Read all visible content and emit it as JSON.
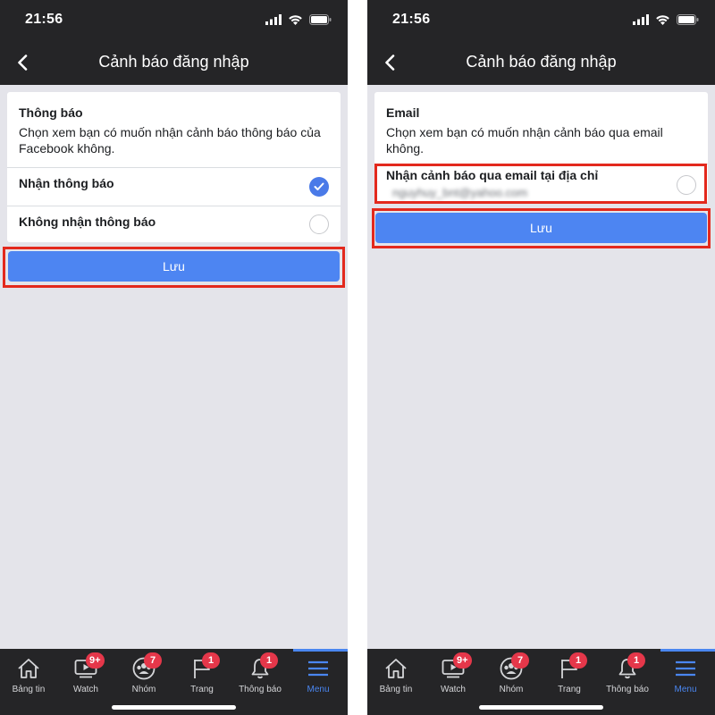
{
  "status": {
    "time": "21:56"
  },
  "colors": {
    "accent": "#4d85f2",
    "highlight": "#e3291d",
    "badge": "#e5374a",
    "bar": "#252527"
  },
  "left": {
    "nav_title": "Cảnh báo đăng nhập",
    "card_title": "Thông báo",
    "card_desc": "Chọn xem bạn có muốn nhận cảnh báo thông báo của Facebook không.",
    "options": [
      {
        "label": "Nhận thông báo",
        "selected": true
      },
      {
        "label": "Không nhận thông báo",
        "selected": false
      }
    ],
    "save_label": "Lưu"
  },
  "right": {
    "nav_title": "Cảnh báo đăng nhập",
    "card_title": "Email",
    "card_desc": "Chọn xem bạn có muốn nhận cảnh báo qua email không.",
    "option_label": "Nhận cảnh báo qua email tại địa chỉ",
    "option_email_blurred": "nguyhuy_bnt@yahoo.com",
    "option_selected": false,
    "save_label": "Lưu"
  },
  "tabbar": {
    "items": [
      {
        "label": "Bảng tin",
        "icon": "home-icon",
        "badge": ""
      },
      {
        "label": "Watch",
        "icon": "watch-icon",
        "badge": "9+"
      },
      {
        "label": "Nhóm",
        "icon": "groups-icon",
        "badge": "7"
      },
      {
        "label": "Trang",
        "icon": "pages-flag-icon",
        "badge": "1"
      },
      {
        "label": "Thông báo",
        "icon": "bell-icon",
        "badge": "1"
      },
      {
        "label": "Menu",
        "icon": "menu-icon",
        "badge": "",
        "active": true
      }
    ]
  }
}
